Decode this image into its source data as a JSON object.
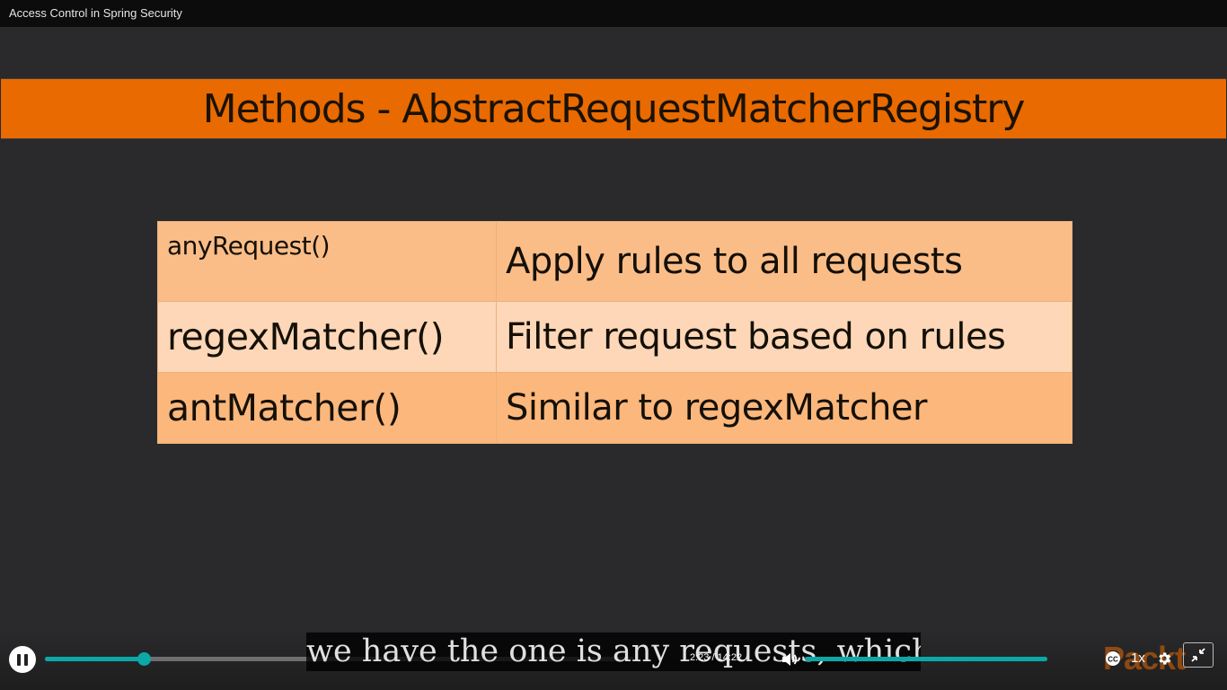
{
  "window": {
    "title": "Access Control in Spring Security"
  },
  "slide": {
    "banner_title": "Methods - AbstractRequestMatcherRegistry",
    "banner_color": "#e86a00",
    "rows": [
      {
        "method": "anyRequest()",
        "description": "Apply rules to all requests"
      },
      {
        "method": "regexMatcher()",
        "description": "Filter request based on rules"
      },
      {
        "method": "antMatcher()",
        "description": "Similar to regexMatcher"
      }
    ]
  },
  "player": {
    "current_time": "2:23",
    "duration": "14:22",
    "time_separator": " / ",
    "progress_fraction": 0.168,
    "volume_fraction": 1.0,
    "accent_color": "#0ca8a8",
    "speed_label": "1x",
    "caption_text": "we have the one is any requests, which we",
    "logo_text": "Packt",
    "icons": {
      "play_pause": "pause-icon",
      "volume": "volume-icon",
      "captions": "cc-icon",
      "settings": "gear-icon",
      "fullscreen": "exit-fullscreen-icon"
    }
  }
}
